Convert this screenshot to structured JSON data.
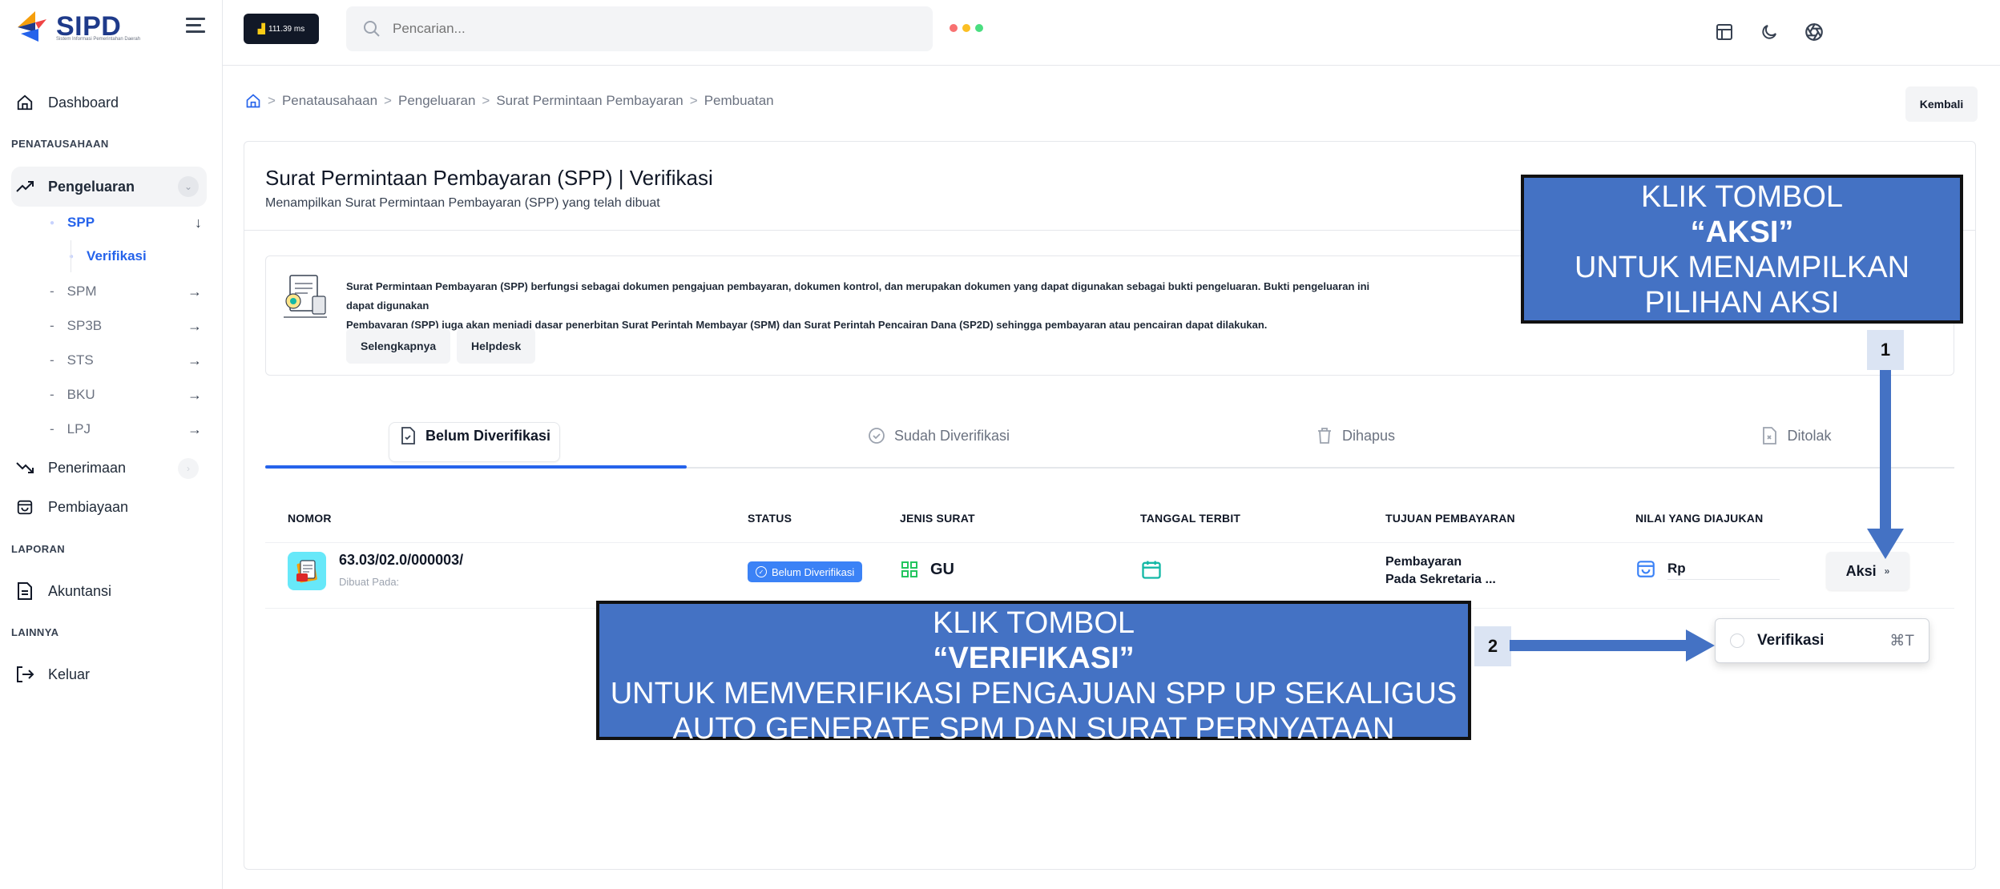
{
  "app": {
    "logo_text": "SIPD",
    "logo_sub": "Sistem Informasi Pemerintahan Daerah"
  },
  "sidebar": {
    "dashboard": "Dashboard",
    "section_penatausahaan": "PENATAUSAHAAN",
    "pengeluaran": "Pengeluaran",
    "spp": "SPP",
    "verifikasi": "Verifikasi",
    "spm": "SPM",
    "sp3b": "SP3B",
    "sts": "STS",
    "bku": "BKU",
    "lpj": "LPJ",
    "penerimaan": "Penerimaan",
    "pembiayaan": "Pembiayaan",
    "section_laporan": "LAPORAN",
    "akuntansi": "Akuntansi",
    "section_lainnya": "LAINNYA",
    "keluar": "Keluar",
    "dash": "-",
    "arrow": "→",
    "down_arrow": "↓"
  },
  "topbar": {
    "speed": "111.39 ms",
    "search_placeholder": "Pencarian...",
    "dot_colors": [
      "#f87171",
      "#fbbf24",
      "#4ade80"
    ]
  },
  "breadcrumb": {
    "items": [
      "Penatausahaan",
      "Pengeluaran",
      "Surat Permintaan Pembayaran",
      "Pembuatan"
    ],
    "separator": ">"
  },
  "main": {
    "kembali": "Kembali",
    "title": "Surat Permintaan Pembayaran (SPP) | Verifikasi",
    "subtitle": "Menampilkan Surat Permintaan Pembayaran (SPP) yang telah dibuat",
    "info_line1": "Surat Permintaan Pembayaran (SPP) berfungsi sebagai dokumen pengajuan pembayaran, dokumen kontrol, dan merupakan dokumen yang dapat digunakan sebagai bukti pengeluaran. Bukti pengeluaran ini dapat digunakan",
    "info_line2": "Pembayaran (SPP) juga akan menjadi dasar penerbitan Surat Perintah Membayar (SPM) dan Surat Perintah Pencairan Dana (SP2D) sehingga pembayaran atau pencairan dapat dilakukan.",
    "btn_selengkapnya": "Selengkapnya",
    "btn_helpdesk": "Helpdesk"
  },
  "tabs": [
    {
      "label": "Belum Diverifikasi"
    },
    {
      "label": "Sudah Diverifikasi"
    },
    {
      "label": "Dihapus"
    },
    {
      "label": "Ditolak"
    }
  ],
  "table": {
    "headers": [
      "NOMOR",
      "STATUS",
      "JENIS SURAT",
      "TANGGAL TERBIT",
      "TUJUAN PEMBAYARAN",
      "NILAI YANG DIAJUKAN"
    ],
    "row": {
      "nomor": "63.03/02.0/000003/",
      "dibuat": "Dibuat Pada:",
      "status": "Belum Diverifikasi",
      "jenis": "GU",
      "tujuan_1": "Pembayaran",
      "tujuan_2": "Pada Sekretaria ...",
      "nilai": "Rp",
      "aksi": "Aksi"
    }
  },
  "dropdown": {
    "label": "Verifikasi",
    "shortcut": "⌘T"
  },
  "annotations": {
    "callout1": {
      "line1": "KLIK TOMBOL",
      "line2": "“AKSI”",
      "line3": "UNTUK MENAMPILKAN",
      "line4": "PILIHAN AKSI"
    },
    "callout2": {
      "line1": "KLIK TOMBOL",
      "line2": "“VERIFIKASI”",
      "line3": "UNTUK MEMVERIFIKASI PENGAJUAN SPP UP SEKALIGUS",
      "line4": "AUTO GENERATE SPM DAN SURAT PERNYATAAN"
    },
    "num1": "1",
    "num2": "2",
    "fill_color": "#4472c4"
  }
}
